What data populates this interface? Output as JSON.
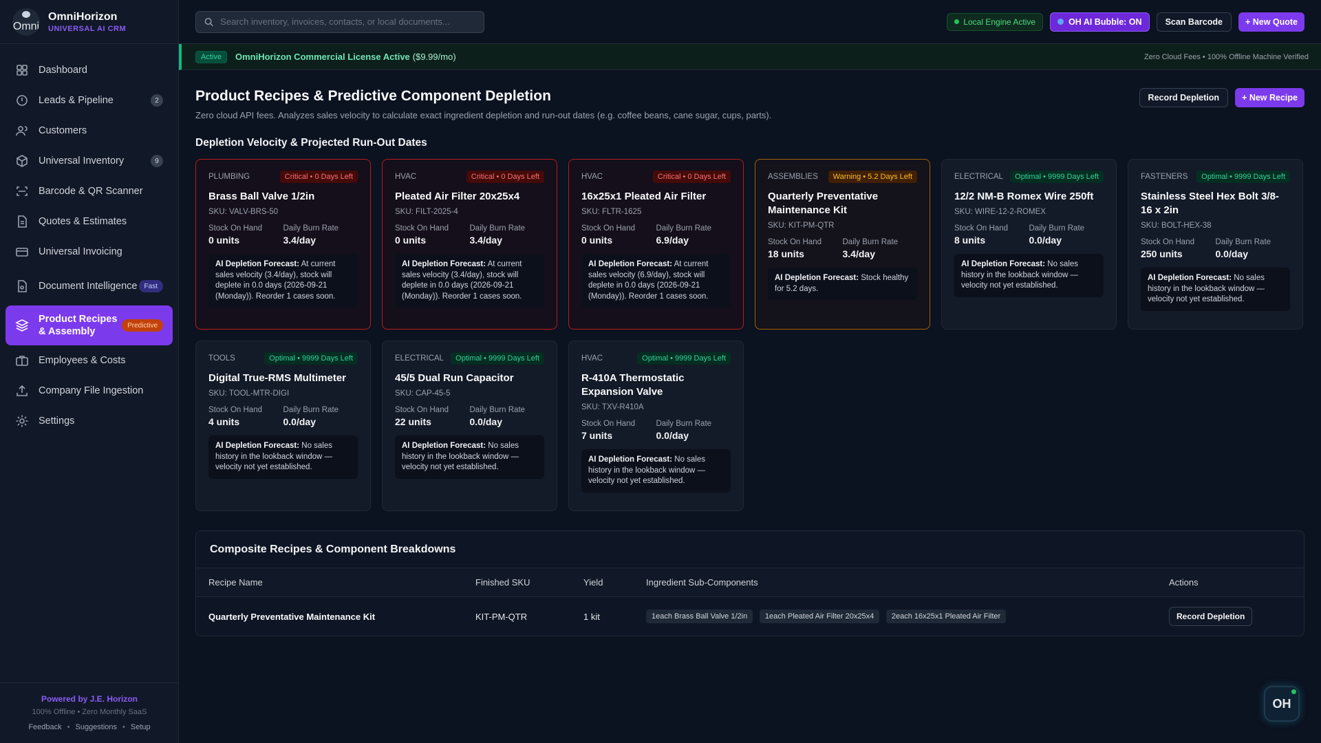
{
  "brand": {
    "logo_text": "Omni",
    "name": "OmniHorizon",
    "subtitle": "UNIVERSAL AI CRM"
  },
  "sidebar": {
    "items": [
      {
        "label": "Dashboard",
        "icon": "dashboard-icon"
      },
      {
        "label": "Leads & Pipeline",
        "icon": "pipeline-icon",
        "badge": "2"
      },
      {
        "label": "Customers",
        "icon": "users-icon"
      },
      {
        "label": "Universal Inventory",
        "icon": "box-icon",
        "badge": "9"
      },
      {
        "label": "Barcode & QR Scanner",
        "icon": "scan-icon"
      },
      {
        "label": "Quotes & Estimates",
        "icon": "document-icon"
      },
      {
        "label": "Universal Invoicing",
        "icon": "card-icon"
      },
      {
        "label": "Document Intelligence",
        "icon": "doc-ai-icon",
        "badge": "Fast"
      },
      {
        "label": "Product Recipes & Assembly",
        "icon": "layers-icon",
        "badge": "Predictive",
        "active": true
      },
      {
        "label": "Employees & Costs",
        "icon": "briefcase-icon"
      },
      {
        "label": "Company File Ingestion",
        "icon": "upload-icon"
      },
      {
        "label": "Settings",
        "icon": "gear-icon"
      }
    ],
    "footer": {
      "powered": "Powered by J.E. Horizon",
      "offline": "100% Offline • Zero Monthly SaaS",
      "links": [
        "Feedback",
        "Suggestions",
        "Setup"
      ]
    }
  },
  "topbar": {
    "search_placeholder": "Search inventory, invoices, contacts, or local documents...",
    "engine_status": "Local Engine Active",
    "bubble_toggle": "OH AI Bubble: ON",
    "scan_barcode": "Scan Barcode",
    "new_quote": "+ New Quote"
  },
  "license": {
    "badge": "Active",
    "title": "OmniHorizon Commercial License Active",
    "price": "($9.99/mo)",
    "right": "Zero Cloud Fees • 100% Offline Machine Verified"
  },
  "page": {
    "title": "Product Recipes & Predictive Component Depletion",
    "description": "Zero cloud API fees. Analyzes sales velocity to calculate exact ingredient depletion and run-out dates (e.g. coffee beans, cane sugar, cups, parts).",
    "record_depletion": "Record Depletion",
    "new_recipe": "+ New Recipe",
    "section_title": "Depletion Velocity & Projected Run-Out Dates"
  },
  "labels": {
    "stock_on_hand": "Stock On Hand",
    "daily_burn_rate": "Daily Burn Rate",
    "forecast_prefix": "AI Depletion Forecast:"
  },
  "cards": [
    {
      "category": "PLUMBING",
      "status": "Critical • 0 Days Left",
      "level": "crit",
      "name": "Brass Ball Valve 1/2in",
      "sku": "SKU: VALV-BRS-50",
      "stock": "0 units",
      "burn": "3.4/day",
      "forecast": "At current sales velocity (3.4/day), stock will deplete in 0.0 days (2026-09-21 (Monday)). Reorder 1 cases soon."
    },
    {
      "category": "HVAC",
      "status": "Critical • 0 Days Left",
      "level": "crit",
      "name": "Pleated Air Filter 20x25x4",
      "sku": "SKU: FILT-2025-4",
      "stock": "0 units",
      "burn": "3.4/day",
      "forecast": "At current sales velocity (3.4/day), stock will deplete in 0.0 days (2026-09-21 (Monday)). Reorder 1 cases soon."
    },
    {
      "category": "HVAC",
      "status": "Critical • 0 Days Left",
      "level": "crit",
      "name": "16x25x1 Pleated Air Filter",
      "sku": "SKU: FLTR-1625",
      "stock": "0 units",
      "burn": "6.9/day",
      "forecast": "At current sales velocity (6.9/day), stock will deplete in 0.0 days (2026-09-21 (Monday)). Reorder 1 cases soon."
    },
    {
      "category": "ASSEMBLIES",
      "status": "Warning • 5.2 Days Left",
      "level": "warn",
      "name": "Quarterly Preventative Maintenance Kit",
      "sku": "SKU: KIT-PM-QTR",
      "stock": "18 units",
      "burn": "3.4/day",
      "forecast": "Stock healthy for 5.2 days."
    },
    {
      "category": "ELECTRICAL",
      "status": "Optimal • 9999 Days Left",
      "level": "opt",
      "name": "12/2 NM-B Romex Wire 250ft",
      "sku": "SKU: WIRE-12-2-ROMEX",
      "stock": "8 units",
      "burn": "0.0/day",
      "forecast": "No sales history in the lookback window — velocity not yet established."
    },
    {
      "category": "FASTENERS",
      "status": "Optimal • 9999 Days Left",
      "level": "opt",
      "name": "Stainless Steel Hex Bolt 3/8-16 x 2in",
      "sku": "SKU: BOLT-HEX-38",
      "stock": "250 units",
      "burn": "0.0/day",
      "forecast": "No sales history in the lookback window — velocity not yet established."
    },
    {
      "category": "TOOLS",
      "status": "Optimal • 9999 Days Left",
      "level": "opt",
      "name": "Digital True-RMS Multimeter",
      "sku": "SKU: TOOL-MTR-DIGI",
      "stock": "4 units",
      "burn": "0.0/day",
      "forecast": "No sales history in the lookback window — velocity not yet established."
    },
    {
      "category": "ELECTRICAL",
      "status": "Optimal • 9999 Days Left",
      "level": "opt",
      "name": "45/5 Dual Run Capacitor",
      "sku": "SKU: CAP-45-5",
      "stock": "22 units",
      "burn": "0.0/day",
      "forecast": "No sales history in the lookback window — velocity not yet established."
    },
    {
      "category": "HVAC",
      "status": "Optimal • 9999 Days Left",
      "level": "opt",
      "name": "R-410A Thermostatic Expansion Valve",
      "sku": "SKU: TXV-R410A",
      "stock": "7 units",
      "burn": "0.0/day",
      "forecast": "No sales history in the lookback window — velocity not yet established."
    }
  ],
  "recipes": {
    "title": "Composite Recipes & Component Breakdowns",
    "headers": [
      "Recipe Name",
      "Finished SKU",
      "Yield",
      "Ingredient Sub-Components",
      "Actions"
    ],
    "rows": [
      {
        "name": "Quarterly Preventative Maintenance Kit",
        "sku": "KIT-PM-QTR",
        "yield": "1 kit",
        "components": [
          "1each Brass Ball Valve 1/2in",
          "1each Pleated Air Filter 20x25x4",
          "2each 16x25x1 Pleated Air Filter"
        ],
        "action": "Record Depletion"
      }
    ]
  },
  "bubble": {
    "label": "OH"
  }
}
